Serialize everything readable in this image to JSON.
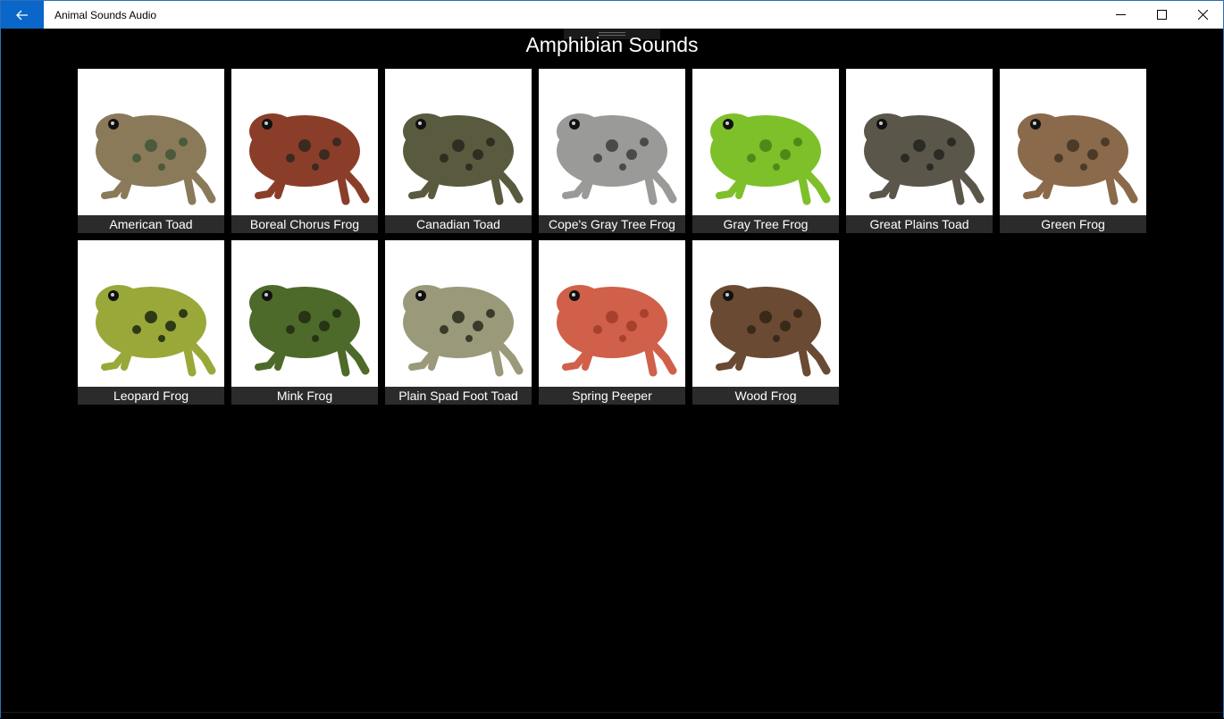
{
  "window": {
    "app_title": "Animal Sounds Audio"
  },
  "page": {
    "title": "Amphibian Sounds"
  },
  "tiles": [
    {
      "label": "American Toad",
      "body": "#8a7a5a",
      "spot": "#4a5a3a"
    },
    {
      "label": "Boreal Chorus Frog",
      "body": "#8a3e2a",
      "spot": "#3a2a20"
    },
    {
      "label": "Canadian Toad",
      "body": "#5a5a3e",
      "spot": "#2e2e22"
    },
    {
      "label": "Cope's Gray Tree Frog",
      "body": "#9a9a98",
      "spot": "#4a4a48"
    },
    {
      "label": "Gray Tree Frog",
      "body": "#7ec02a",
      "spot": "#4f8a18"
    },
    {
      "label": "Great Plains Toad",
      "body": "#5a564a",
      "spot": "#2c2a24"
    },
    {
      "label": "Green Frog",
      "body": "#8a6a4a",
      "spot": "#4a3a2a"
    },
    {
      "label": "Leopard Frog",
      "body": "#9aa83a",
      "spot": "#2e3a14"
    },
    {
      "label": "Mink Frog",
      "body": "#4e6a2a",
      "spot": "#263414"
    },
    {
      "label": "Plain Spad Foot Toad",
      "body": "#9a9a7a",
      "spot": "#3a3a2a"
    },
    {
      "label": "Spring Peeper",
      "body": "#d0604a",
      "spot": "#a8402e"
    },
    {
      "label": "Wood Frog",
      "body": "#6a4a32",
      "spot": "#3a2818"
    }
  ]
}
